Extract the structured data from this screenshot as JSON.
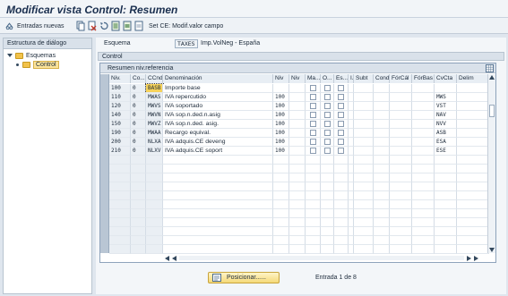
{
  "title": "Modificar vista Control: Resumen",
  "toolbar": {
    "new_entries": "Entradas nuevas",
    "set_label": "Set CE: Modif.valor campo"
  },
  "left_panel": {
    "header": "Estructura de diálogo",
    "tree": [
      {
        "label": "Esquemas"
      },
      {
        "label": "Control"
      }
    ]
  },
  "scheme": {
    "label": "Esquema",
    "value": "TAXES",
    "description": "Imp.VolNeg - España"
  },
  "section_title": "Control",
  "table": {
    "caption": "Resumen niv.referencia",
    "columns": [
      "Niv.",
      "Co...",
      "CCnd",
      "Denominación",
      "Niv",
      "Niv",
      "Ma...",
      "O...",
      "Es...",
      "I.",
      "Subt",
      "Cond",
      "FórCál",
      "FórBas",
      "CvCta",
      "Delim"
    ],
    "rows": [
      {
        "niv": "100",
        "co": "0",
        "ccnd": "BASB",
        "denom": "Importe base",
        "niv2": "",
        "cvcta": ""
      },
      {
        "niv": "110",
        "co": "0",
        "ccnd": "MWAS",
        "denom": "IVA repercutido",
        "niv2": "100",
        "cvcta": "MWS"
      },
      {
        "niv": "120",
        "co": "0",
        "ccnd": "MWVS",
        "denom": "IVA soportado",
        "niv2": "100",
        "cvcta": "VST"
      },
      {
        "niv": "140",
        "co": "0",
        "ccnd": "MWVN",
        "denom": "IVA sop.n.ded.n.asig",
        "niv2": "100",
        "cvcta": "NAV"
      },
      {
        "niv": "150",
        "co": "0",
        "ccnd": "MWVZ",
        "denom": "IVA sop.n.ded. asig.",
        "niv2": "100",
        "cvcta": "NVV"
      },
      {
        "niv": "190",
        "co": "0",
        "ccnd": "MWAA",
        "denom": "Recargo equival.",
        "niv2": "100",
        "cvcta": "ASB"
      },
      {
        "niv": "200",
        "co": "0",
        "ccnd": "NLXA",
        "denom": "IVA adquis.CE deveng",
        "niv2": "100",
        "cvcta": "ESA"
      },
      {
        "niv": "210",
        "co": "0",
        "ccnd": "NLXV",
        "denom": "IVA adquis.CE soport",
        "niv2": "100",
        "cvcta": "ESE"
      }
    ]
  },
  "footer": {
    "position_button": "Posicionar......",
    "entry_text": "Entrada 1 de 8"
  },
  "icons": [
    "glasses-icon",
    "copy-icon",
    "delete-icon",
    "undo-icon",
    "select-all-icon",
    "select-block-icon",
    "deselect-icon",
    "settings-icon",
    "arrow-first-icon",
    "arrow-prev-icon",
    "arrow-next-icon",
    "arrow-last-icon"
  ],
  "colors": {
    "accent": "#f5d977",
    "header_bg": "#d9e1ea"
  }
}
